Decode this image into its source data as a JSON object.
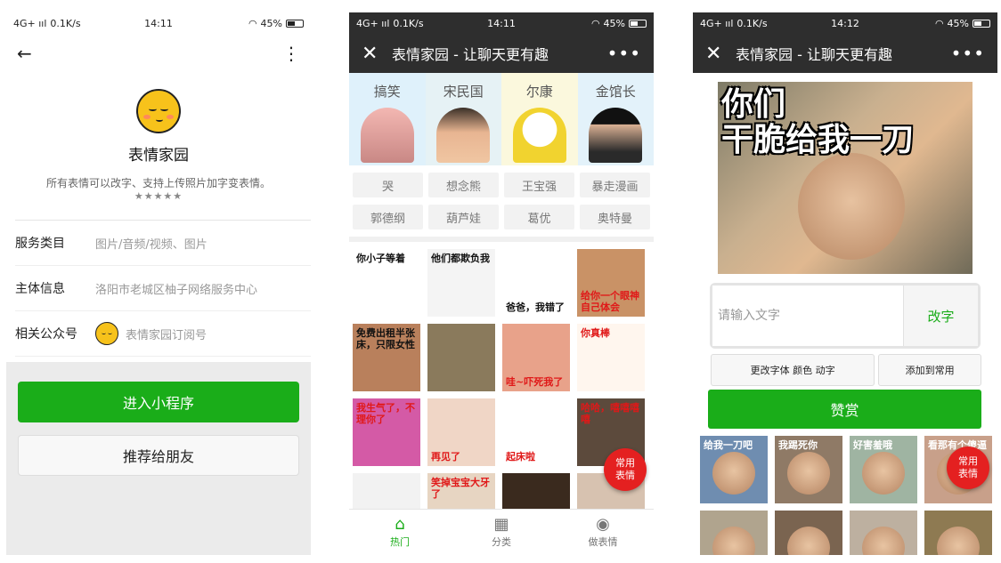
{
  "status": {
    "network": "4G+ ııl",
    "speed1": "0.1K/s",
    "speed3": "0.1K/s",
    "time1": "14:11",
    "time2": "14:11",
    "time3": "14:12",
    "battery": "45%"
  },
  "profile": {
    "back_icon": "←",
    "more_icon": "⋮",
    "name": "表情家园",
    "description": "所有表情可以改字、支持上传照片加字变表情。",
    "stars": "★★★★★",
    "rows": [
      {
        "key": "服务类目",
        "value": "图片/音频/视频、图片"
      },
      {
        "key": "主体信息",
        "value": "洛阳市老城区柚子网络服务中心"
      },
      {
        "key": "相关公众号",
        "value": "表情家园订阅号"
      }
    ],
    "enter_button": "进入小程序",
    "share_button": "推荐给朋友"
  },
  "navbar": {
    "close_icon": "✕",
    "title": "表情家园 - 让聊天更有趣",
    "more_icon": "•••"
  },
  "home": {
    "categories": [
      "搞笑",
      "宋民国",
      "尔康",
      "金馆长"
    ],
    "tags": [
      "哭",
      "想念熊",
      "王宝强",
      "暴走漫画",
      "郭德纲",
      "葫芦娃",
      "葛优",
      "奥特曼"
    ],
    "stickers": [
      {
        "caption": "你小子等着",
        "bg": "#ffffff",
        "style": ""
      },
      {
        "caption": "他们都欺负我",
        "bg": "#f4f4f4",
        "style": ""
      },
      {
        "caption": "爸爸，我错了",
        "bg": "#ffffff",
        "style": "bottom"
      },
      {
        "caption": "给你一个眼神自己体会",
        "bg": "#c99266",
        "style": "bottom red"
      },
      {
        "caption": "免费出租半张床，只限女性",
        "bg": "#b9805c",
        "style": ""
      },
      {
        "caption": "",
        "bg": "#8a7a5c",
        "style": ""
      },
      {
        "caption": "哇~吓死我了",
        "bg": "#e8a28a",
        "style": "bottom red"
      },
      {
        "caption": "你真棒",
        "bg": "#fff6ee",
        "style": "red"
      },
      {
        "caption": "我生气了，不理你了",
        "bg": "#d45aa6",
        "style": "red"
      },
      {
        "caption": "再见了",
        "bg": "#f0d6c6",
        "style": "bottom red"
      },
      {
        "caption": "起床啦",
        "bg": "#ffffff",
        "style": "bottom red"
      },
      {
        "caption": "哈哈，嘻嘻嘻嘻",
        "bg": "#5c4a3c",
        "style": "red"
      },
      {
        "caption": "",
        "bg": "#f2f2f2",
        "style": ""
      },
      {
        "caption": "笑掉宝宝大牙了",
        "bg": "#e7d5c2",
        "style": "red"
      },
      {
        "caption": "",
        "bg": "#3a2a1e",
        "style": ""
      },
      {
        "caption": "",
        "bg": "#d7c2b0",
        "style": ""
      }
    ],
    "fab": "常用表情",
    "tabs": [
      {
        "icon": "⌂",
        "label": "热门"
      },
      {
        "icon": "▦",
        "label": "分类"
      },
      {
        "icon": "◉",
        "label": "做表情"
      }
    ]
  },
  "editor": {
    "hero_text_line1": "你们",
    "hero_text_line2": "干脆给我一刀",
    "input_placeholder": "请输入文字",
    "input_value": "",
    "change_text_button": "改字",
    "style_button": "更改字体 颜色 动字",
    "add_button": "添加到常用",
    "reward_button": "赞赏",
    "fab": "常用表情",
    "stickers": [
      {
        "caption": "给我一刀吧",
        "bg": "#6f8db0"
      },
      {
        "caption": "我踢死你",
        "bg": "#8f7a66"
      },
      {
        "caption": "好害羞哦",
        "bg": "#9fb4a2"
      },
      {
        "caption": "看那有个傻逼",
        "bg": "#c8a08a"
      },
      {
        "caption": "",
        "bg": "#b0a48e"
      },
      {
        "caption": "",
        "bg": "#7a6450"
      },
      {
        "caption": "",
        "bg": "#bdb0a0"
      },
      {
        "caption": "",
        "bg": "#8e7a52"
      }
    ]
  }
}
